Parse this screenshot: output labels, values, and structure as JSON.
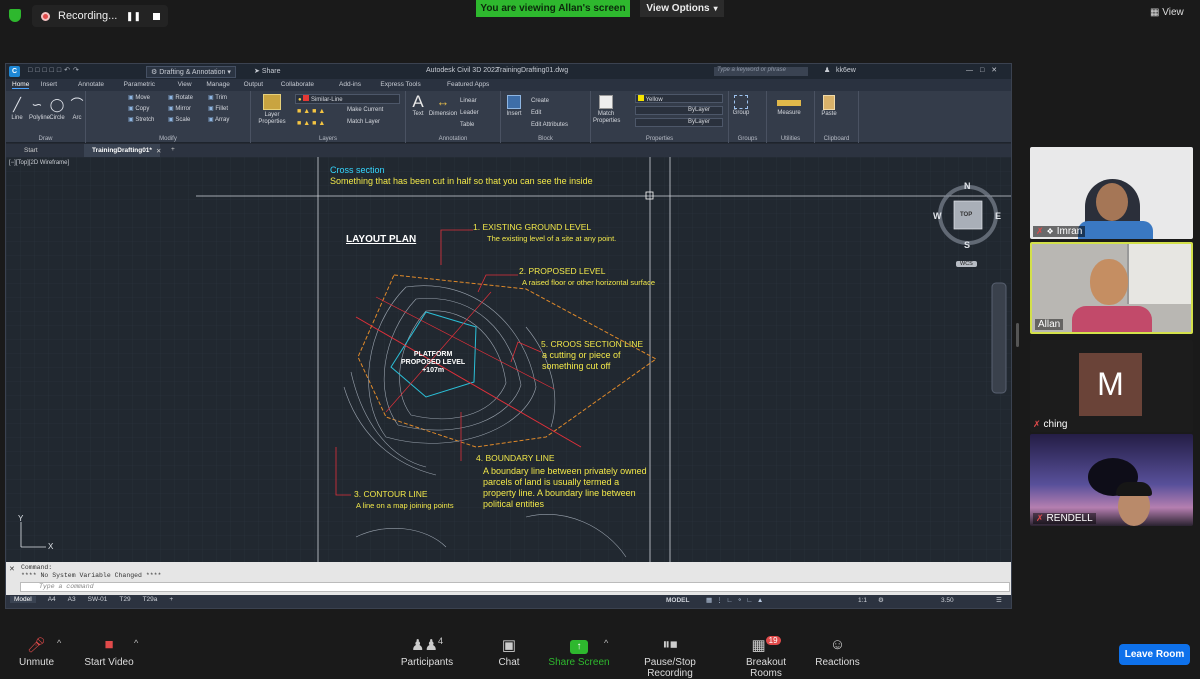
{
  "zoom": {
    "recording_label": "Recording...",
    "viewing_banner": "You are viewing Allan's screen",
    "view_options": "View Options",
    "view_label": "View"
  },
  "cad": {
    "app_title": "Autodesk Civil 3D 2022",
    "file_title": "TrainingDrafting01.dwg",
    "workspace": "Drafting & Annotation",
    "share": "Share",
    "search_placeholder": "Type a keyword or phrase",
    "user": "kk6ew",
    "ribbon_tabs": [
      "Home",
      "Insert",
      "Annotate",
      "Parametric",
      "View",
      "Manage",
      "Output",
      "Collaborate",
      "Add-ins",
      "Express Tools",
      "Featured Apps"
    ],
    "groups": {
      "draw": "Draw",
      "modify": "Modify",
      "layers": "Layers",
      "annotation": "Annotation",
      "block": "Block",
      "properties": "Properties",
      "groups": "Groups",
      "utilities": "Utilities",
      "clipboard": "Clipboard"
    },
    "draw_tools": [
      "Line",
      "Polyline",
      "Circle",
      "Arc"
    ],
    "modify_tools": [
      "Move",
      "Rotate",
      "Trim",
      "Copy",
      "Mirror",
      "Fillet",
      "Stretch",
      "Scale",
      "Array"
    ],
    "layer_props": "Layer Properties",
    "layer_name": "Similar-Line",
    "make_current": "Make Current",
    "match_layer": "Match Layer",
    "text": "Text",
    "dimension": "Dimension",
    "linear": "Linear",
    "leader": "Leader",
    "table": "Table",
    "insert": "Insert",
    "create": "Create",
    "edit": "Edit",
    "edit_attributes": "Edit Attributes",
    "match_properties": "Match Properties",
    "color": "Yellow",
    "bylayer1": "ByLayer",
    "bylayer2": "ByLayer",
    "group": "Group",
    "measure": "Measure",
    "paste": "Paste",
    "doc_tabs": [
      "Start",
      "TrainingDrafting01*"
    ],
    "viewport_label": "[−][Top][2D Wireframe]",
    "viewcube": {
      "n": "N",
      "s": "S",
      "e": "E",
      "w": "W",
      "top": "TOP",
      "wcs": "WCS"
    },
    "command_label": "Command:",
    "command_history": "**** No System Variable Changed ****",
    "command_placeholder": "Type a command",
    "layout_tabs": [
      "Model",
      "A4",
      "A3",
      "SW-01",
      "T29",
      "T29a"
    ],
    "status_model": "MODEL",
    "status_scale": "3.50",
    "status_scale_text": "1:1"
  },
  "drawing": {
    "cross_title": "Cross section",
    "cross_desc": "Something that has been cut in half so that you can see the inside",
    "layout_plan": "LAYOUT PLAN",
    "n1_title": "1.   EXISTING GROUND LEVEL",
    "n1_desc": "The existing level of a site at any point.",
    "n2_title": "2. PROPOSED LEVEL",
    "n2_desc": "A raised floor or other horizontal surface",
    "n5_title": "5. CROOS SECTION LINE",
    "n5_desc1": "a cutting or piece of",
    "n5_desc2": "something cut off",
    "platform1": "PLATFORM",
    "platform2": "PROPOSED LEVEL",
    "platform3": "+107m",
    "n4_title": "4. BOUNDARY LINE",
    "n4_desc1": "A boundary line between privately owned",
    "n4_desc2": "parcels of land is usually termed a",
    "n4_desc3": "property line. A boundary line between",
    "n4_desc4": "political entities",
    "n3_title": "3. CONTOUR LINE",
    "n3_desc": "A line on a map joining points",
    "axis_y": "Y",
    "axis_x": "X"
  },
  "participants_panel": [
    {
      "name": "Imran",
      "muted": true,
      "pinned": true
    },
    {
      "name": "Allan",
      "muted": false,
      "active": true
    },
    {
      "name": "ching",
      "muted": true,
      "initial": "M"
    },
    {
      "name": "RENDELL",
      "muted": true
    }
  ],
  "toolbar": {
    "unmute": "Unmute",
    "start_video": "Start Video",
    "participants": "Participants",
    "participants_count": "4",
    "chat": "Chat",
    "share_screen": "Share Screen",
    "pause_recording": "Pause/Stop Recording",
    "breakout": "Breakout Rooms",
    "breakout_badge": "19",
    "reactions": "Reactions",
    "leave": "Leave Room"
  },
  "colors": {
    "zoom_green": "#2eb82e",
    "cad_bg": "#212830",
    "annotation_yellow": "#f2e84a",
    "annotation_cyan": "#35d7ff",
    "leader_red": "#e0303a",
    "boundary_orange": "#e08a2a",
    "leave_blue": "#0e71eb"
  }
}
